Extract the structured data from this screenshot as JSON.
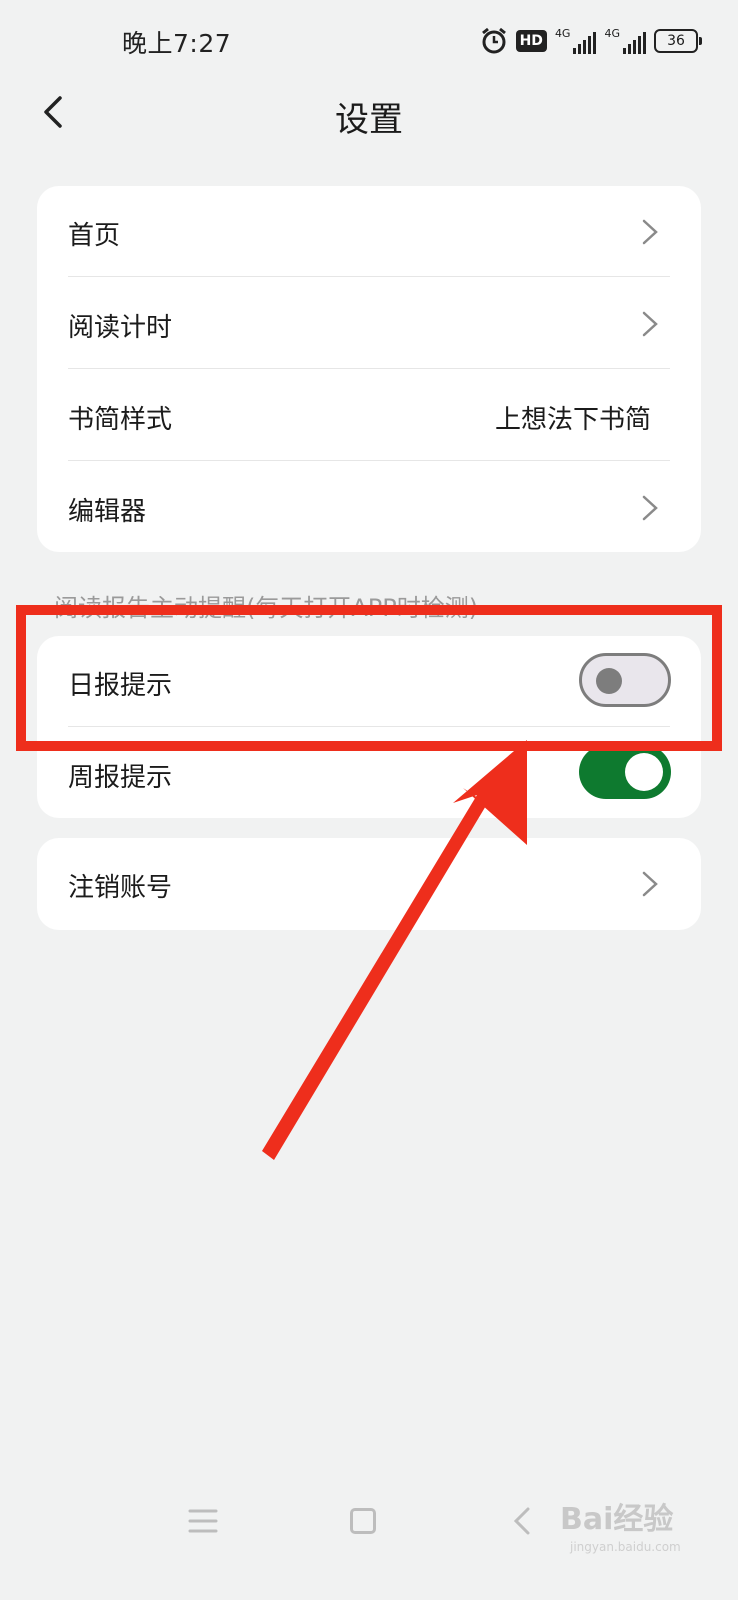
{
  "status_bar": {
    "time": "晚上7:27",
    "hd_badge": "HD",
    "net1": "4G",
    "net2": "4G",
    "battery": "36"
  },
  "header": {
    "title": "设置"
  },
  "settings": {
    "items": [
      {
        "label": "首页"
      },
      {
        "label": "阅读计时"
      },
      {
        "label": "书简样式",
        "value": "上想法下书简"
      },
      {
        "label": "编辑器"
      }
    ]
  },
  "reminders": {
    "section_label": "阅读报告主动提醒(每天打开APP时检测)",
    "items": [
      {
        "label": "日报提示",
        "enabled": false
      },
      {
        "label": "周报提示",
        "enabled": true
      }
    ]
  },
  "account": {
    "cancel_label": "注销账号"
  },
  "watermark": {
    "text": "Bai经验",
    "sub": "jingyan.baidu.com"
  },
  "colors": {
    "accent_toggle": "#0e7a2f",
    "annotation": "#ee2e1c"
  }
}
